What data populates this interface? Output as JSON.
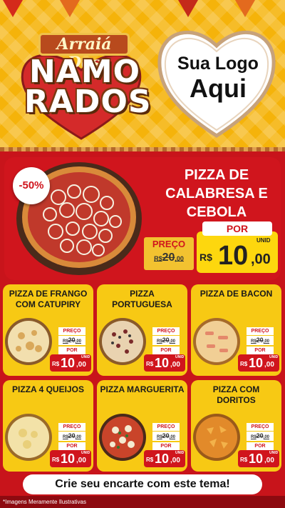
{
  "header": {
    "event_title_top": "Arraiá Dos",
    "event_title_main_1": "NAMO",
    "event_title_main_2": "RADOS",
    "logo_line1": "Sua Logo",
    "logo_line2": "Aqui"
  },
  "hero": {
    "discount": "-50%",
    "name": "PIZZA DE CALABRESA E CEBOLA",
    "price_label": "PREÇO",
    "old_currency": "R$",
    "old_price": "20",
    "old_cents": ",00",
    "por_label": "POR",
    "new_currency": "R$",
    "new_int": "10",
    "new_dec": ",00",
    "unit": "UNID"
  },
  "products": [
    {
      "name": "PIZZA DE FRANGO COM CATUPIRY",
      "price_label": "PREÇO",
      "old_currency": "R$",
      "old_price": "20",
      "old_cents": ",00",
      "por_label": "POR",
      "new_currency": "R$",
      "new_int": "10",
      "new_dec": ",00",
      "unit": "UNID"
    },
    {
      "name": "PIZZA PORTUGUESA",
      "price_label": "PREÇO",
      "old_currency": "R$",
      "old_price": "20",
      "old_cents": ",00",
      "por_label": "POR",
      "new_currency": "R$",
      "new_int": "10",
      "new_dec": ",00",
      "unit": "UNID"
    },
    {
      "name": "PIZZA DE BACON",
      "price_label": "PREÇO",
      "old_currency": "R$",
      "old_price": "20",
      "old_cents": ",00",
      "por_label": "POR",
      "new_currency": "R$",
      "new_int": "10",
      "new_dec": ",00",
      "unit": "UNID"
    },
    {
      "name": "PIZZA 4 QUEIJOS",
      "price_label": "PREÇO",
      "old_currency": "R$",
      "old_price": "20",
      "old_cents": ",00",
      "por_label": "POR",
      "new_currency": "R$",
      "new_int": "10",
      "new_dec": ",00",
      "unit": "UNID"
    },
    {
      "name": "PIZZA MARGUERITA",
      "price_label": "PREÇO",
      "old_currency": "R$",
      "old_price": "20",
      "old_cents": ",00",
      "por_label": "POR",
      "new_currency": "R$",
      "new_int": "10",
      "new_dec": ",00",
      "unit": "UNID"
    },
    {
      "name": "PIZZA COM DORITOS",
      "price_label": "PREÇO",
      "old_currency": "R$",
      "old_price": "20",
      "old_cents": ",00",
      "por_label": "POR",
      "new_currency": "R$",
      "new_int": "10",
      "new_dec": ",00",
      "unit": "UNID"
    }
  ],
  "footer": {
    "cta": "Crie seu encarte com este tema!",
    "disclaimer": "*Imagens Meramente Ilustrativas"
  },
  "colors": {
    "brand_red": "#d0151d",
    "brand_yellow": "#f7c914",
    "header_yellow": "#f5b30a"
  },
  "icons": [
    "heart-frame-icon",
    "pizza-image",
    "bunting-flag-icon"
  ]
}
